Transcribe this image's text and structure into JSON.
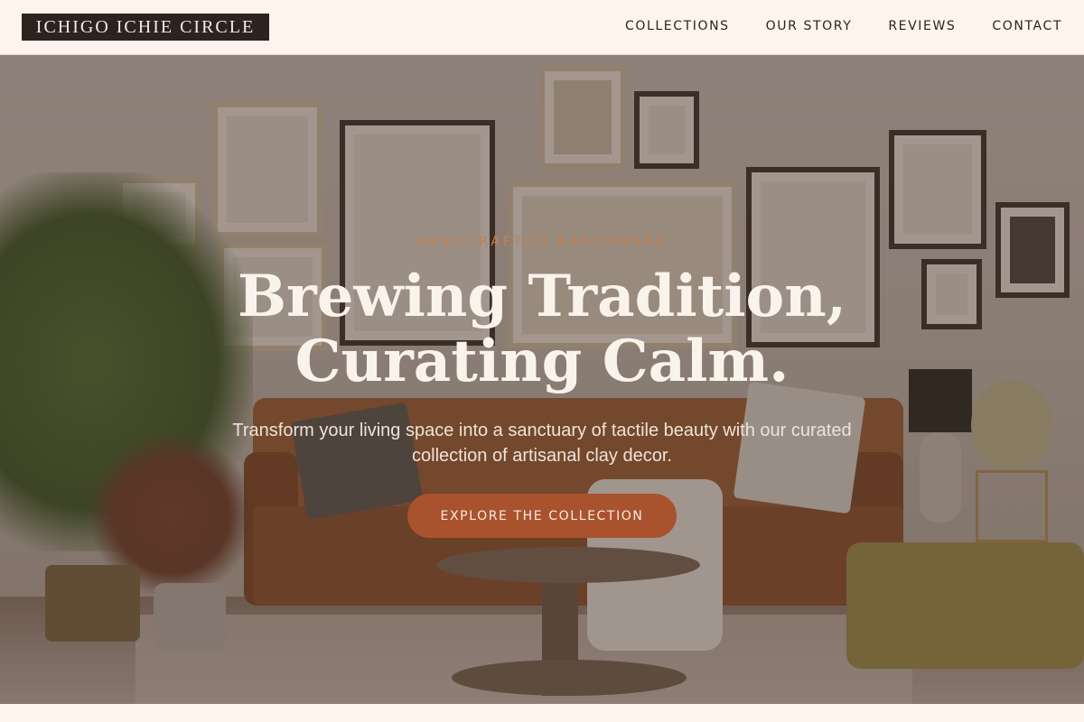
{
  "brand": {
    "name": "ICHIGO ICHIE CIRCLE"
  },
  "nav": {
    "items": [
      {
        "label": "COLLECTIONS"
      },
      {
        "label": "OUR STORY"
      },
      {
        "label": "REVIEWS"
      },
      {
        "label": "CONTACT"
      }
    ]
  },
  "hero": {
    "eyebrow": "HANDCRAFTED EARTHWARE",
    "headline_line1": "Brewing Tradition,",
    "headline_line2": "Curating Calm.",
    "subtext": "Transform your living space into a sanctuary of tactile beauty with our curated collection of artisanal clay decor.",
    "cta_label": "EXPLORE THE COLLECTION"
  },
  "colors": {
    "background": "#fdf4ee",
    "logo_bg": "#2d221e",
    "accent": "#a9532e",
    "eyebrow": "#c5804f",
    "heading": "#faf3ec"
  },
  "images": {
    "hero_background": "living-room-with-gallery-wall-and-leather-sofa"
  }
}
